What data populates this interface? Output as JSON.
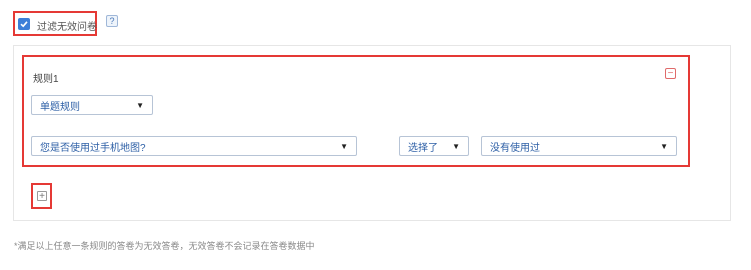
{
  "filter": {
    "label": "过滤无效问卷",
    "checked": true,
    "help_label": "?"
  },
  "rule": {
    "title": "规则1",
    "type_select": "单题规则",
    "question_select": "您是否使用过手机地图?",
    "operator_select": "选择了",
    "answer_select": "没有使用过",
    "remove_label": "−"
  },
  "add_label": "+",
  "note": "*满足以上任意一条规则的答卷为无效答卷，无效答卷不会记录在答卷数据中",
  "colors": {
    "highlight": "#e53935",
    "accent": "#3d7fd8",
    "select_text": "#2d5fa6"
  }
}
